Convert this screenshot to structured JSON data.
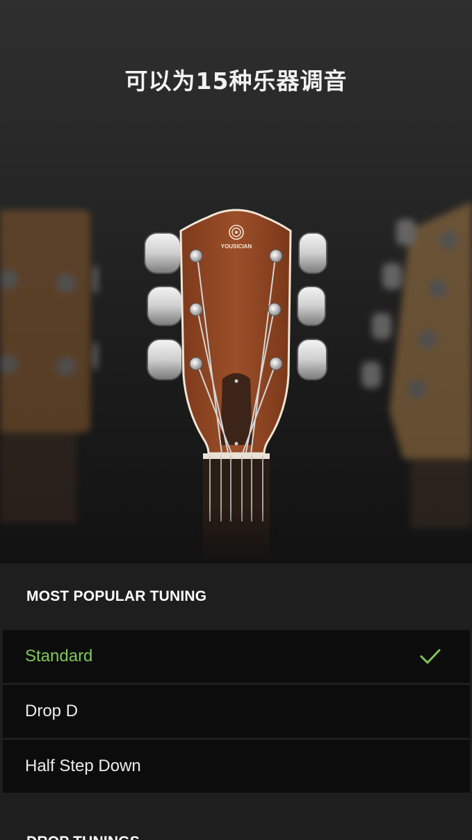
{
  "header": {
    "title": "可以为15种乐器调音"
  },
  "headstock": {
    "brand": "YOUSICIAN"
  },
  "sections": [
    {
      "title": "MOST POPULAR TUNING",
      "items": [
        {
          "label": "Standard",
          "selected": true
        },
        {
          "label": "Drop D",
          "selected": false
        },
        {
          "label": "Half Step Down",
          "selected": false
        }
      ]
    },
    {
      "title": "DROP TUNINGS",
      "items": []
    }
  ],
  "colors": {
    "accent": "#7ec85a",
    "background": "#1e1e1e",
    "row": "#0c0c0c"
  },
  "icons": {
    "selected": "check-icon",
    "logo": "fingerprint-logo-icon"
  }
}
